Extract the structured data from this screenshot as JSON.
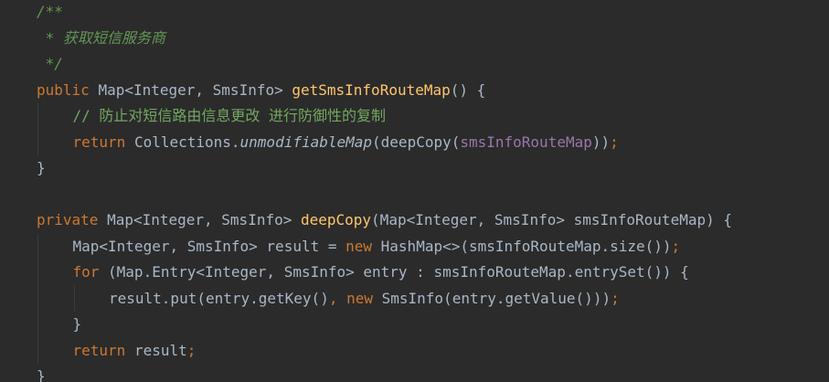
{
  "colors": {
    "background": "#2b2b2b",
    "text": "#a9b7c6",
    "keyword": "#cc7832",
    "method": "#ffc66d",
    "doc_comment": "#629755",
    "line_comment": "#72a85f",
    "field": "#9876aa"
  },
  "lines": [
    {
      "indent": 0,
      "tokens": [
        {
          "t": "/**",
          "k": "doc"
        }
      ]
    },
    {
      "indent": 0,
      "tokens": [
        {
          "t": " * 获取短信服务商",
          "k": "doc"
        }
      ]
    },
    {
      "indent": 0,
      "tokens": [
        {
          "t": " */",
          "k": "doc"
        }
      ]
    },
    {
      "indent": 0,
      "tokens": [
        {
          "t": "public ",
          "k": "kw"
        },
        {
          "t": "Map<Integer, SmsInfo> ",
          "k": "txt"
        },
        {
          "t": "getSmsInfoRouteMap",
          "k": "fn"
        },
        {
          "t": "() {",
          "k": "txt"
        }
      ]
    },
    {
      "indent": 1,
      "tokens": [
        {
          "t": "// 防止对短信路由信息更改 进行防御性的复制",
          "k": "cmt"
        }
      ]
    },
    {
      "indent": 1,
      "tokens": [
        {
          "t": "return ",
          "k": "kw"
        },
        {
          "t": "Collections.",
          "k": "txt"
        },
        {
          "t": "unmodifiableMap",
          "k": "ital"
        },
        {
          "t": "(deepCopy(",
          "k": "txt"
        },
        {
          "t": "smsInfoRouteMap",
          "k": "fld"
        },
        {
          "t": "))",
          "k": "txt"
        },
        {
          "t": ";",
          "k": "kw"
        }
      ]
    },
    {
      "indent": 0,
      "tokens": [
        {
          "t": "}",
          "k": "txt"
        }
      ]
    },
    {
      "indent": 0,
      "tokens": []
    },
    {
      "indent": 0,
      "tokens": [
        {
          "t": "private ",
          "k": "kw"
        },
        {
          "t": "Map<Integer, SmsInfo> ",
          "k": "txt"
        },
        {
          "t": "deepCopy",
          "k": "fn"
        },
        {
          "t": "(Map<Integer, SmsInfo> smsInfoRouteMap) {",
          "k": "txt"
        }
      ]
    },
    {
      "indent": 1,
      "tokens": [
        {
          "t": "Map<Integer, SmsInfo> result = ",
          "k": "txt"
        },
        {
          "t": "new ",
          "k": "kw"
        },
        {
          "t": "HashMap<>(smsInfoRouteMap.size())",
          "k": "txt"
        },
        {
          "t": ";",
          "k": "kw"
        }
      ]
    },
    {
      "indent": 1,
      "tokens": [
        {
          "t": "for ",
          "k": "kw"
        },
        {
          "t": "(Map.Entry<Integer, SmsInfo> entry : smsInfoRouteMap.entrySet()) {",
          "k": "txt"
        }
      ]
    },
    {
      "indent": 2,
      "tokens": [
        {
          "t": "result.put(entry.getKey()",
          "k": "txt"
        },
        {
          "t": ", ",
          "k": "kw"
        },
        {
          "t": "new ",
          "k": "kw"
        },
        {
          "t": "SmsInfo(entry.getValue()))",
          "k": "txt"
        },
        {
          "t": ";",
          "k": "kw"
        }
      ]
    },
    {
      "indent": 1,
      "tokens": [
        {
          "t": "}",
          "k": "txt"
        }
      ]
    },
    {
      "indent": 1,
      "tokens": [
        {
          "t": "return ",
          "k": "kw"
        },
        {
          "t": "result",
          "k": "txt"
        },
        {
          "t": ";",
          "k": "kw"
        }
      ]
    },
    {
      "indent": 0,
      "tokens": [
        {
          "t": "}",
          "k": "txt"
        }
      ]
    }
  ]
}
